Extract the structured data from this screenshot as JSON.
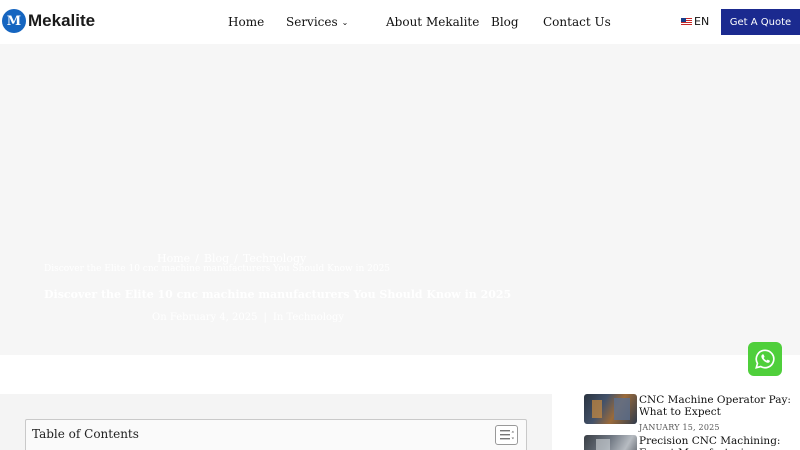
{
  "header": {
    "logo_text": "Mekalite",
    "logo_mark": "M",
    "nav": [
      {
        "label": "Home"
      },
      {
        "label": "Services"
      },
      {
        "label": "About Mekalite"
      },
      {
        "label": "Blog"
      },
      {
        "label": "Contact Us"
      }
    ],
    "language": "EN",
    "quote_button": "Get A Quote"
  },
  "hero": {
    "breadcrumb": [
      "Home",
      "Blog",
      "Technology"
    ],
    "breadcrumb_current": "Discover the Elite 10 cnc machine manufacturers You Should Know in 2025",
    "title": "Discover the Elite 10 cnc machine manufacturers You Should Know in 2025",
    "meta_date": "On February 4, 2025",
    "meta_category": "In Technology"
  },
  "toc": {
    "title": "Table of Contents"
  },
  "sidebar": {
    "posts": [
      {
        "title": "CNC Machine Operator Pay: What to Expect",
        "date": "JANUARY 15, 2025"
      },
      {
        "title": "Precision CNC Machining: Expert Manufacturing Services",
        "date": ""
      }
    ]
  },
  "icons": {
    "whatsapp": "whatsapp-icon",
    "flag": "us-flag-icon",
    "toc_toggle": "list-toggle-icon",
    "chevron": "chevron-down-icon"
  },
  "colors": {
    "brand_blue": "#1565c0",
    "quote_button": "#1b2a8f",
    "whatsapp": "#4fcf3b"
  }
}
